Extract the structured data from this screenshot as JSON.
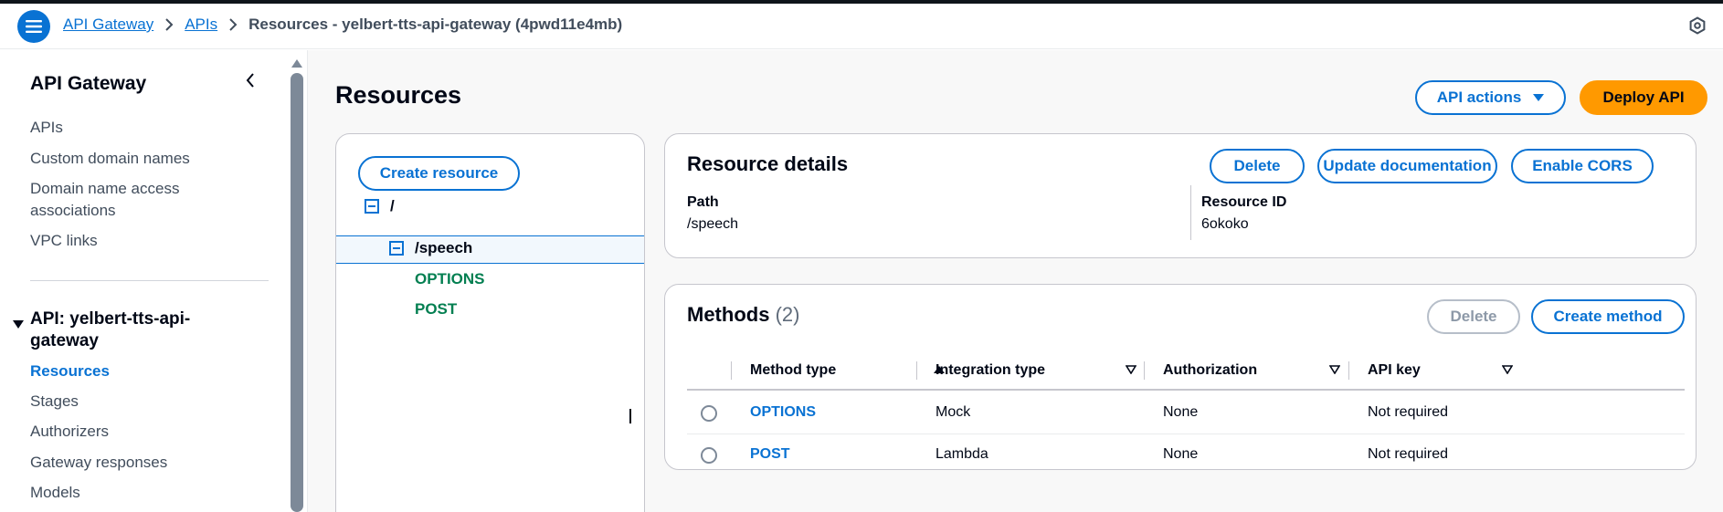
{
  "breadcrumb": {
    "items": [
      "API Gateway",
      "APIs"
    ],
    "current": "Resources - yelbert-tts-api-gateway (4pwd11e4mb)"
  },
  "sidebar": {
    "title": "API Gateway",
    "items": [
      "APIs",
      "Custom domain names",
      "Domain name access associations",
      "VPC links"
    ],
    "section_title": "API: yelbert-tts-api-gateway",
    "section_items": [
      "Resources",
      "Stages",
      "Authorizers",
      "Gateway responses",
      "Models"
    ],
    "active_item": "Resources"
  },
  "page": {
    "title": "Resources",
    "api_actions_label": "API actions",
    "deploy_label": "Deploy API"
  },
  "tree": {
    "create_resource_label": "Create resource",
    "root": "/",
    "child": "/speech",
    "methods": [
      "OPTIONS",
      "POST"
    ]
  },
  "resource_details": {
    "title": "Resource details",
    "delete_label": "Delete",
    "update_doc_label": "Update documentation",
    "enable_cors_label": "Enable CORS",
    "path_label": "Path",
    "path_value": "/speech",
    "id_label": "Resource ID",
    "id_value": "6okoko"
  },
  "methods": {
    "title": "Methods",
    "count": "(2)",
    "delete_label": "Delete",
    "create_label": "Create method",
    "columns": [
      "Method type",
      "Integration type",
      "Authorization",
      "API key"
    ],
    "rows": [
      {
        "method": "OPTIONS",
        "integration": "Mock",
        "authorization": "None",
        "api_key": "Not required"
      },
      {
        "method": "POST",
        "integration": "Lambda",
        "authorization": "None",
        "api_key": "Not required"
      }
    ]
  },
  "colors": {
    "accent": "#0972d3",
    "primary_button": "#ff9900",
    "method_green": "#037f51"
  }
}
